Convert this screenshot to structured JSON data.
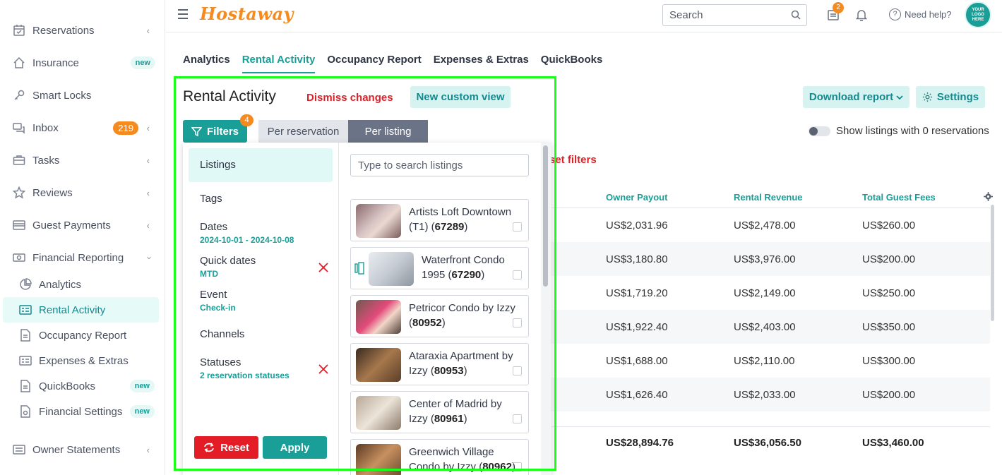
{
  "brand": {
    "logo": "Hostaway",
    "avatar_text": "YOUR LOGO HERE",
    "accent": "#1a9e98",
    "orange": "#f58b1f",
    "red": "#d8232a"
  },
  "topbar": {
    "search_placeholder": "Search",
    "calendar_badge": "2",
    "help": "Need help?"
  },
  "sidebar": {
    "items": [
      {
        "label": "Reservations",
        "icon": "calendar-icon"
      },
      {
        "label": "Insurance",
        "icon": "home-icon",
        "badge": "new"
      },
      {
        "label": "Smart Locks",
        "icon": "key-icon"
      },
      {
        "label": "Inbox",
        "icon": "chat-icon",
        "count": "219"
      },
      {
        "label": "Tasks",
        "icon": "briefcase-icon"
      },
      {
        "label": "Reviews",
        "icon": "star-icon"
      },
      {
        "label": "Guest Payments",
        "icon": "card-icon"
      },
      {
        "label": "Financial Reporting",
        "icon": "money-icon"
      }
    ],
    "sub_items": [
      {
        "label": "Analytics",
        "icon": "pie-icon"
      },
      {
        "label": "Rental Activity",
        "icon": "list-icon",
        "active": true
      },
      {
        "label": "Occupancy Report",
        "icon": "doc-icon"
      },
      {
        "label": "Expenses & Extras",
        "icon": "list-icon"
      },
      {
        "label": "QuickBooks",
        "icon": "doc-icon",
        "badge": "new"
      },
      {
        "label": "Financial Settings",
        "icon": "gear-doc-icon",
        "badge": "new"
      }
    ],
    "owner_statements": "Owner Statements"
  },
  "tabs": [
    "Analytics",
    "Rental Activity",
    "Occupancy Report",
    "Expenses & Extras",
    "QuickBooks"
  ],
  "header": {
    "title": "Rental Activity",
    "dismiss": "Dismiss changes",
    "new_view": "New custom view",
    "download": "Download report",
    "settings": "Settings",
    "toggle_label": "Show listings with 0 reservations",
    "reset_filters": "set filters"
  },
  "filter_bar": {
    "filters": "Filters",
    "filters_count": "4",
    "per_reservation": "Per reservation",
    "per_listing": "Per listing"
  },
  "filter_panel": {
    "items": [
      {
        "name": "Listings",
        "sub": ""
      },
      {
        "name": "Tags",
        "sub": ""
      },
      {
        "name": "Dates",
        "sub": "2024-10-01 - 2024-10-08"
      },
      {
        "name": "Quick dates",
        "sub": "MTD"
      },
      {
        "name": "Event",
        "sub": "Check-in"
      },
      {
        "name": "Channels",
        "sub": ""
      },
      {
        "name": "Statuses",
        "sub": "2 reservation statuses"
      }
    ],
    "reset": "Reset",
    "apply": "Apply",
    "search_placeholder": "Type to search listings",
    "listings": [
      {
        "name": "Artists Loft Downtown (T1)",
        "id": "67289"
      },
      {
        "name": "Waterfront Condo 1995",
        "id": "67290"
      },
      {
        "name": "Petricor Condo by Izzy",
        "id": "80952"
      },
      {
        "name": "Ataraxia Apartment by Izzy",
        "id": "80953"
      },
      {
        "name": "Center of Madrid by Izzy",
        "id": "80961"
      },
      {
        "name": "Greenwich Village Condo by Izzy",
        "id": "80962"
      }
    ]
  },
  "table": {
    "columns": [
      "Owner Payout",
      "Rental Revenue",
      "Total Guest Fees"
    ],
    "rows": [
      [
        "US$2,031.96",
        "US$2,478.00",
        "US$260.00"
      ],
      [
        "US$3,180.80",
        "US$3,976.00",
        "US$200.00"
      ],
      [
        "US$1,719.20",
        "US$2,149.00",
        "US$250.00"
      ],
      [
        "US$1,922.40",
        "US$2,403.00",
        "US$350.00"
      ],
      [
        "US$1,688.00",
        "US$2,110.00",
        "US$300.00"
      ],
      [
        "US$1,626.40",
        "US$2,033.00",
        "US$200.00"
      ]
    ],
    "totals": [
      "US$28,894.76",
      "US$36,056.50",
      "US$3,460.00"
    ]
  }
}
